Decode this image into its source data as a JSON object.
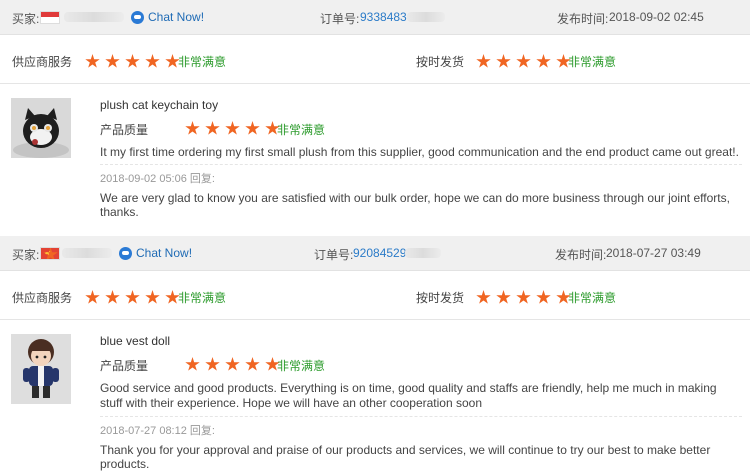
{
  "colors": {
    "star": "#f06522",
    "verdict": "#2c9b2c",
    "link": "#2b7bc8",
    "header_bg": "#f0f0f0"
  },
  "reviews": [
    {
      "buyer_label": "买家:",
      "flag": "singapore-flag-icon",
      "chat_label": "Chat Now!",
      "order_label": "订单号:",
      "order_number": "9338483",
      "date_label": "发布时间:",
      "date": "2018-09-02 02:45",
      "supplier_service_label": "供应商服务",
      "supplier_service_rating": 5,
      "supplier_service_verdict": "非常满意",
      "shipping_label": "按时发货",
      "shipping_rating": 5,
      "shipping_verdict": "非常满意",
      "product_title": "plush cat keychain toy",
      "quality_label": "产品质量",
      "quality_rating": 5,
      "quality_verdict": "非常满意",
      "comment": "It my first time ordering my first small plush from this supplier, good communication and the end product came out great!.",
      "reply_meta": "2018-09-02 05:06  回复:",
      "reply": "We are very glad to know you are satisfied with our bulk order, hope we can do more business through our joint efforts, thanks."
    },
    {
      "buyer_label": "买家:",
      "flag": "china-flag-icon",
      "chat_label": "Chat Now!",
      "order_label": "订单号:",
      "order_number": "92084529",
      "date_label": "发布时间:",
      "date": "2018-07-27 03:49",
      "supplier_service_label": "供应商服务",
      "supplier_service_rating": 5,
      "supplier_service_verdict": "非常满意",
      "shipping_label": "按时发货",
      "shipping_rating": 5,
      "shipping_verdict": "非常满意",
      "product_title": "blue vest doll",
      "quality_label": "产品质量",
      "quality_rating": 5,
      "quality_verdict": "非常满意",
      "comment": "Good service and good products. Everything is on time, good quality and staffs are friendly, help me much in making stuff with their experience. Hope we will have an other cooperation soon",
      "reply_meta": "2018-07-27 08:12  回复:",
      "reply": "Thank you for your approval and praise of our products and services, we will continue to try our best to make better products."
    }
  ]
}
